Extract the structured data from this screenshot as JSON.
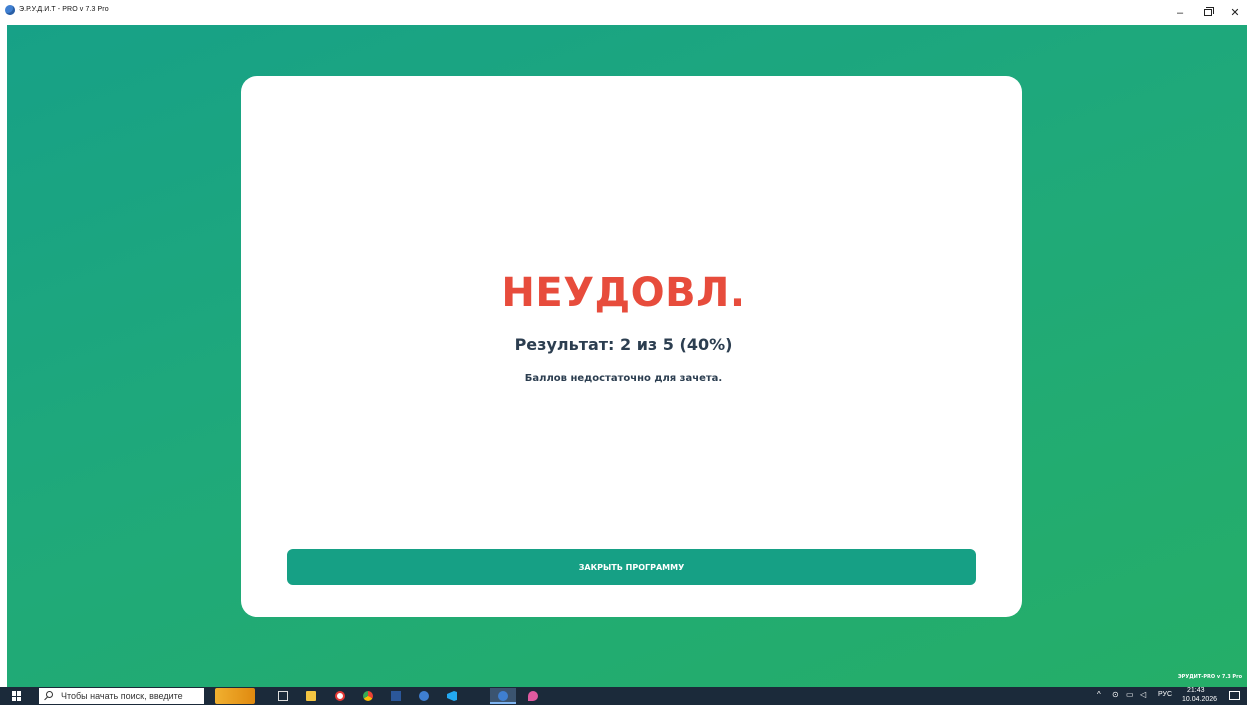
{
  "window": {
    "title": "Э.Р.У.Д.И.Т - PRO v 7.3 Pro",
    "minimize": "–",
    "close": "✕"
  },
  "result_card": {
    "verdict": "НЕУДОВЛ.",
    "result_text": "Результат: 2 из 5 (40%)",
    "note": "Баллов недостаточно для зачета.",
    "close_button": "ЗАКРЫТЬ ПРОГРАММУ"
  },
  "watermark": "ЭРУДИТ-PRO v 7.3 Pro",
  "taskbar": {
    "search_placeholder": "Чтобы начать поиск, введите",
    "tray_chevron": "^",
    "language": "РУС",
    "time": "21:43",
    "date": "10.04.2026"
  },
  "colors": {
    "background_gradient_start": "#17a187",
    "background_gradient_end": "#25ae68",
    "verdict": "#e74c3c",
    "button": "#16a085",
    "text_dark": "#2c3e50"
  }
}
